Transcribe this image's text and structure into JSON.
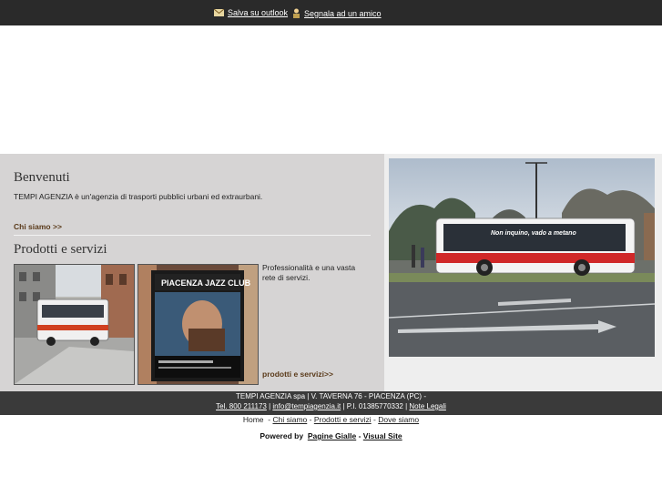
{
  "topbar": {
    "outlook_label": "Salva su outlook",
    "friend_label": "Segnala ad un amico"
  },
  "welcome": {
    "title": "Benvenuti",
    "text": "TEMPI AGENZIA è un'agenzia di trasporti pubblici urbani ed extraurbani.",
    "more_label": "Chi siamo >>"
  },
  "services": {
    "title": "Prodotti e servizi",
    "text": "Professionalità e una vasta rete di servizi.",
    "more_label": "prodotti e servizi>>",
    "poster_text": "PIACENZA JAZZ CLUB"
  },
  "hero": {
    "bus_slogan": "Non inquino, vado a metano"
  },
  "footer": {
    "company": "TEMPI AGENZIA spa",
    "address": "V. TAVERNA 76 - PIACENZA (PC) -",
    "phone": "Tel. 800 211173",
    "email": "info@tempiagenzia.it",
    "vat": "P.I. 01385770332",
    "legal": "Note Legali"
  },
  "nav": {
    "items": [
      "Home",
      "Chi siamo",
      "Prodotti e servizi",
      "Dove siamo"
    ]
  },
  "powered": {
    "label": "Powered by",
    "link1": "Pagine Gialle",
    "separator": "-",
    "link2": "Visual Site"
  },
  "colors": {
    "topbar": "#2a2a2a",
    "panel": "#d6d4d4",
    "link_brown": "#5a3a1a"
  }
}
